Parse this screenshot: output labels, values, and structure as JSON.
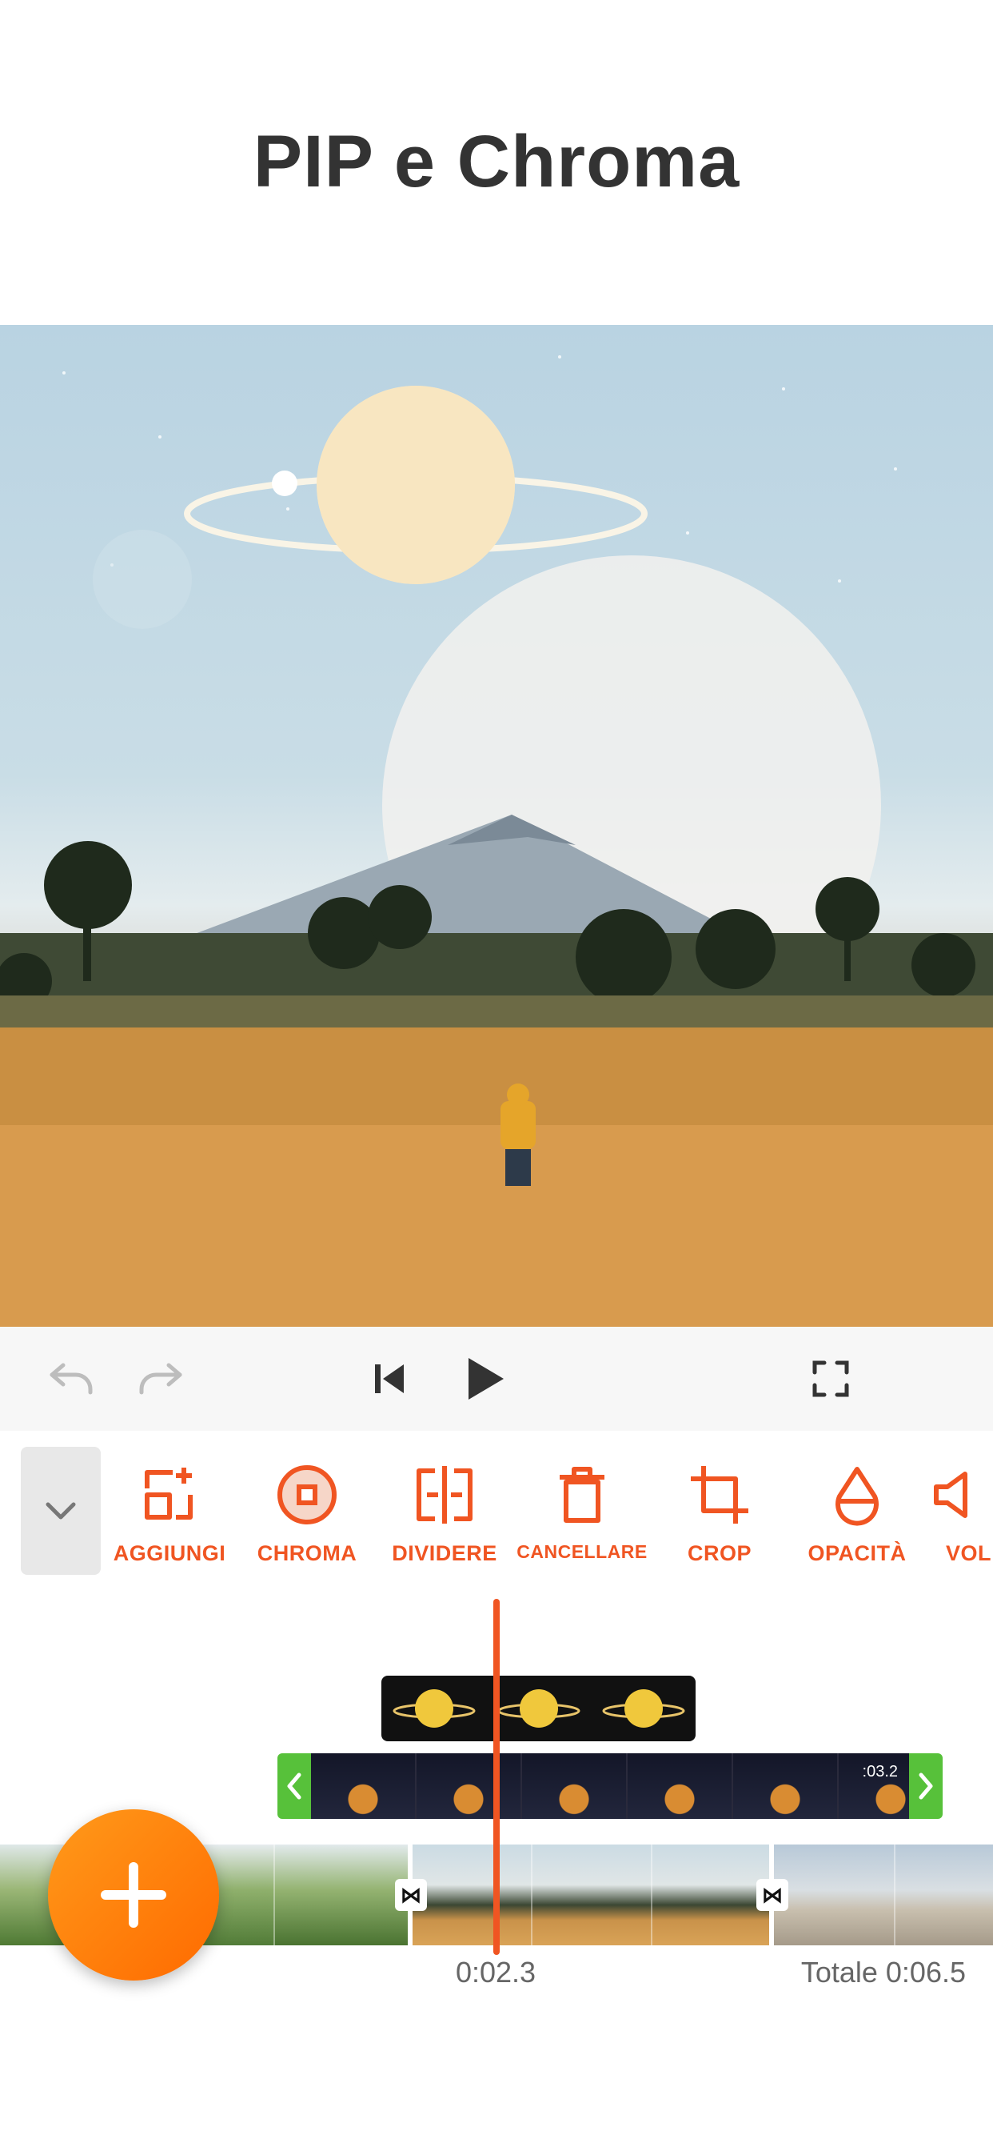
{
  "header": {
    "title": "PIP e Chroma"
  },
  "colors": {
    "accent": "#f05522",
    "trim": "#57c13a",
    "fab": "#ff7a00"
  },
  "preview": {
    "description_icon": "landscape-preview"
  },
  "controls": {
    "undo": "undo-icon",
    "redo": "redo-icon",
    "skip_start": "skip-start-icon",
    "play": "play-icon",
    "fullscreen": "fullscreen-icon"
  },
  "toolbar": {
    "tools": [
      {
        "label": "AGGIUNGI",
        "icon": "add-layer-icon"
      },
      {
        "label": "CHROMA",
        "icon": "chroma-icon"
      },
      {
        "label": "DIVIDERE",
        "icon": "split-icon"
      },
      {
        "label": "CANCELLARE",
        "icon": "delete-icon"
      },
      {
        "label": "CROP",
        "icon": "crop-icon"
      },
      {
        "label": "OPACITÀ",
        "icon": "opacity-icon"
      },
      {
        "label": "VOL",
        "icon": "volume-icon"
      }
    ]
  },
  "timeline": {
    "pip_clip_duration": ":03.2",
    "current_time": "0:02.3",
    "total_time": "Totale 0:06.5"
  }
}
